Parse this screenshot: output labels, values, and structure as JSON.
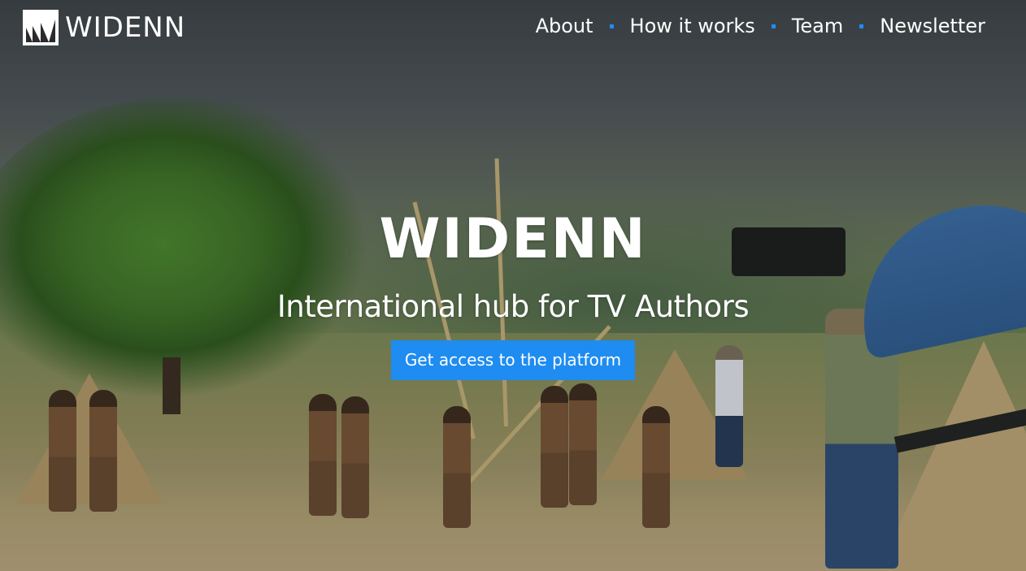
{
  "brand": {
    "logo_text": "WIDENN"
  },
  "nav": {
    "items": [
      {
        "label": "About"
      },
      {
        "label": "How it works"
      },
      {
        "label": "Team"
      },
      {
        "label": "Newsletter"
      }
    ]
  },
  "hero": {
    "title": "WIDENN",
    "subtitle": "International hub for TV Authors",
    "cta_label": "Get access to the platform"
  },
  "colors": {
    "accent": "#1e8cf0",
    "nav_separator": "#1e8cff",
    "text": "#ffffff"
  },
  "icons": {
    "logo_mark": "widenn-logo-icon"
  }
}
